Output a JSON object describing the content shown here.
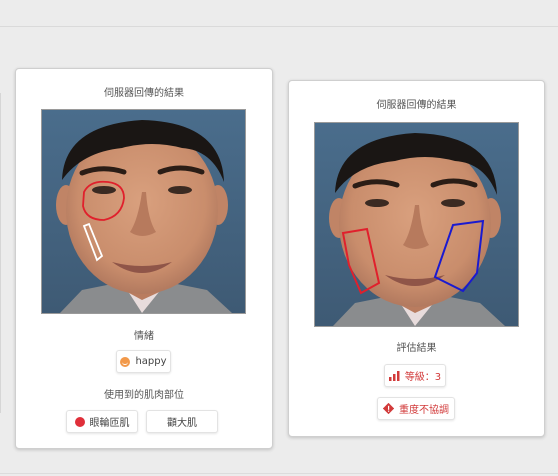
{
  "cards": [
    {
      "title": "伺服器回傳的結果",
      "emotion_label": "情緒",
      "emotion_value": "happy",
      "muscles_label": "使用到的肌肉部位",
      "muscles": [
        "眼輪匝肌",
        "顴大肌"
      ]
    },
    {
      "title": "伺服器回傳的結果",
      "result_label": "評估結果",
      "grade_text": "等級：3",
      "severity_text": "重度不協調"
    }
  ],
  "colors": {
    "annotation_red": "#e0202c",
    "annotation_white": "#ffffff",
    "annotation_blue": "#1a1ad0",
    "chip_red_text": "#d23a3a",
    "photo_background": "#4e6b86"
  },
  "icons": {
    "emotion": "smile-icon",
    "muscle_marker": "red-dot-icon",
    "grade": "bar-chart-icon",
    "severity": "warning-icon"
  }
}
